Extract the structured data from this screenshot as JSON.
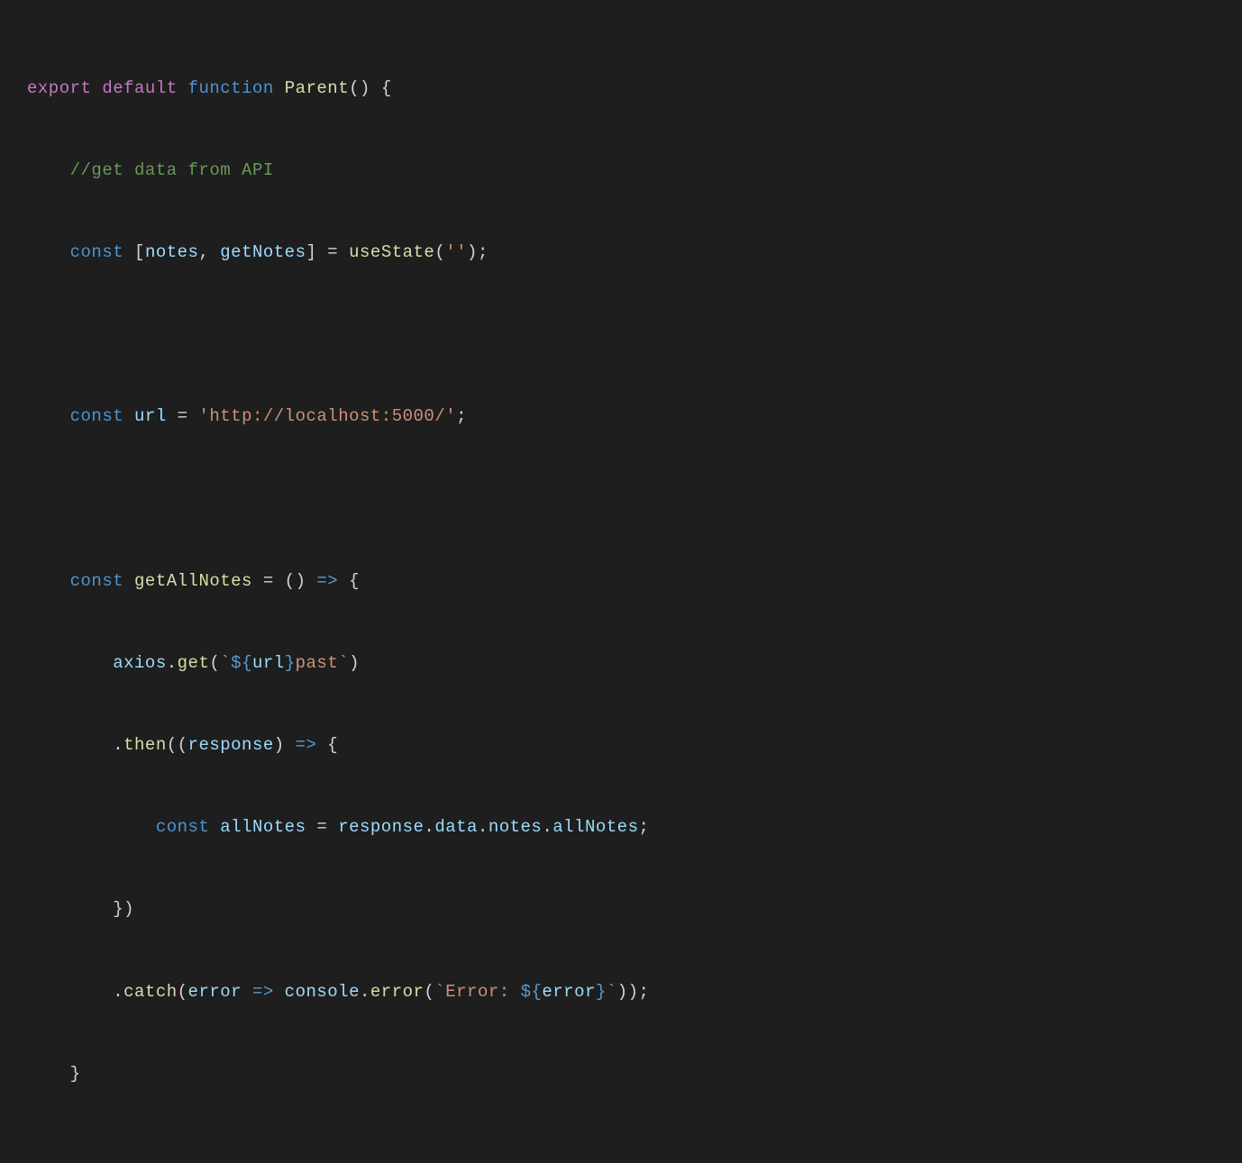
{
  "line1": {
    "export": "export",
    "default": "default",
    "function": "function",
    "fname": "Parent",
    "parens": "()",
    "brace": " {"
  },
  "line2": {
    "comment": "//get data from API"
  },
  "line3": {
    "const": "const",
    "lbracket": "[",
    "notes": "notes",
    "comma": ",",
    "getNotes": "getNotes",
    "rbracket": "]",
    "eq": " = ",
    "useState": "useState",
    "lparen": "(",
    "str": "''",
    "rparen": ")",
    "semi": ";"
  },
  "line4": {
    "const": "const",
    "url": "url",
    "eq": " = ",
    "str": "'http://localhost:5000/'",
    "semi": ";"
  },
  "line5": {
    "const": "const",
    "getAllNotes": "getAllNotes",
    "eq": " = ",
    "parens": "()",
    "arrow": " => ",
    "brace": "{"
  },
  "line6": {
    "axios": "axios",
    "dot": ".",
    "get": "get",
    "lparen": "(",
    "bt1": "`",
    "dollar": "$",
    "lbrace": "{",
    "url": "url",
    "rbrace": "}",
    "past": "past",
    "bt2": "`",
    "rparen": ")"
  },
  "line7": {
    "dot": ".",
    "then": "then",
    "lparen": "(",
    "lparen2": "(",
    "response": "response",
    "rparen2": ")",
    "arrow": " => ",
    "brace": "{"
  },
  "line8": {
    "const": "const",
    "allNotes": "allNotes",
    "eq": " = ",
    "response": "response",
    "dot1": ".",
    "data": "data",
    "dot2": ".",
    "notes": "notes",
    "dot3": ".",
    "allNotesRight": "allNotes",
    "semi": ";"
  },
  "line9": {
    "brace": "})"
  },
  "line10": {
    "dot": ".",
    "catch": "catch",
    "lparen": "(",
    "error": "error",
    "arrow": " => ",
    "console": "console",
    "dot2": ".",
    "errorFn": "error",
    "lparen2": "(",
    "bt1": "`",
    "errStr": "Error: ",
    "dollar": "$",
    "lbrace": "{",
    "errorVar": "error",
    "rbrace": "}",
    "bt2": "`",
    "rparen2": ")",
    "rparen": ")",
    "semi": ";"
  },
  "line11": {
    "brace": "}"
  }
}
